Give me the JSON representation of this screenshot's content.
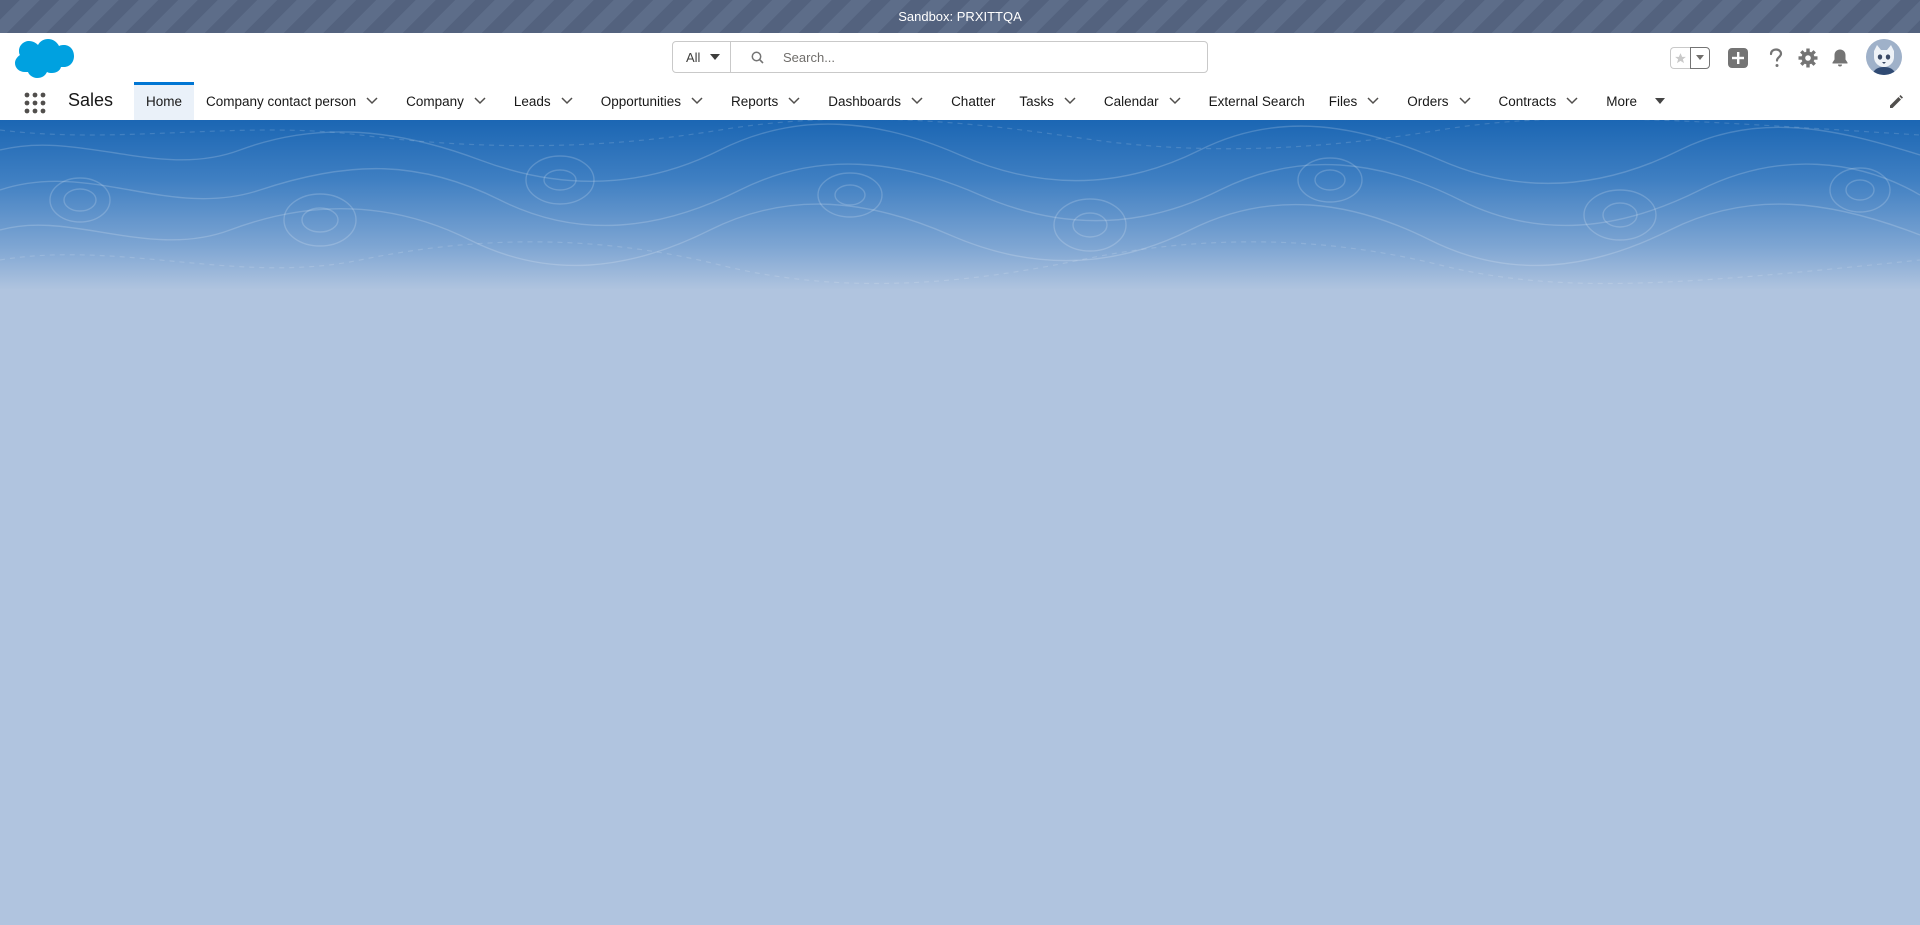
{
  "sandbox": {
    "label": "Sandbox: PRXITTQA"
  },
  "header": {
    "search": {
      "scope": "All",
      "placeholder": "Search..."
    },
    "icons": [
      "salesforce-cloud-logo",
      "favorites-star-icon",
      "chevron-down-icon",
      "add-icon",
      "help-icon",
      "setup-gear-icon",
      "notification-bell-icon",
      "user-avatar"
    ]
  },
  "nav": {
    "app_name": "Sales",
    "items": [
      {
        "label": "Home",
        "dropdown": false,
        "active": true
      },
      {
        "label": "Company contact person",
        "dropdown": true
      },
      {
        "label": "Company",
        "dropdown": true
      },
      {
        "label": "Leads",
        "dropdown": true
      },
      {
        "label": "Opportunities",
        "dropdown": true
      },
      {
        "label": "Reports",
        "dropdown": true
      },
      {
        "label": "Dashboards",
        "dropdown": true
      },
      {
        "label": "Chatter",
        "dropdown": false
      },
      {
        "label": "Tasks",
        "dropdown": true
      },
      {
        "label": "Calendar",
        "dropdown": true
      },
      {
        "label": "External Search",
        "dropdown": false
      },
      {
        "label": "Files",
        "dropdown": true
      },
      {
        "label": "Orders",
        "dropdown": true
      },
      {
        "label": "Contracts",
        "dropdown": true
      },
      {
        "label": "More",
        "dropdown": true
      }
    ]
  },
  "colors": {
    "brand": "#0176d3",
    "nav_border": "#1b5297",
    "page_background": "#b0c4df",
    "sandbox_bar": "#53627e"
  }
}
